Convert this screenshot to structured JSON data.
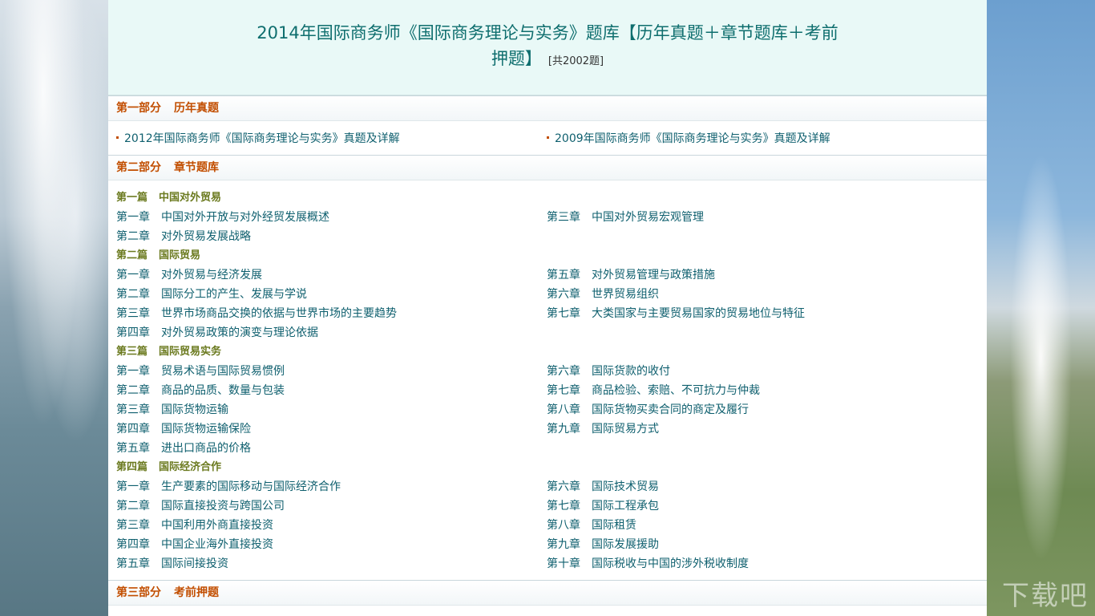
{
  "title_line1": "2014年国际商务师《国际商务理论与实务》题库【历年真题＋章节题库＋考前",
  "title_line2": "押题】",
  "title_count": "[共2002题]",
  "watermark": "下载吧",
  "sections": [
    {
      "label": "第一部分",
      "name": "历年真题",
      "links": [
        "2012年国际商务师《国际商务理论与实务》真题及详解",
        "2009年国际商务师《国际商务理论与实务》真题及详解"
      ]
    },
    {
      "label": "第二部分",
      "name": "章节题库",
      "parts": [
        {
          "label": "第一篇",
          "name": "中国对外贸易",
          "rows": [
            [
              {
                "n": "第一章",
                "t": "中国对外开放与对外经贸发展概述"
              },
              {
                "n": "第三章",
                "t": "中国对外贸易宏观管理"
              }
            ],
            [
              {
                "n": "第二章",
                "t": "对外贸易发展战略"
              },
              null
            ]
          ]
        },
        {
          "label": "第二篇",
          "name": "国际贸易",
          "rows": [
            [
              {
                "n": "第一章",
                "t": "对外贸易与经济发展"
              },
              {
                "n": "第五章",
                "t": "对外贸易管理与政策措施"
              }
            ],
            [
              {
                "n": "第二章",
                "t": "国际分工的产生、发展与学说"
              },
              {
                "n": "第六章",
                "t": "世界贸易组织"
              }
            ],
            [
              {
                "n": "第三章",
                "t": "世界市场商品交换的依据与世界市场的主要趋势"
              },
              {
                "n": "第七章",
                "t": "大类国家与主要贸易国家的贸易地位与特征"
              }
            ],
            [
              {
                "n": "第四章",
                "t": "对外贸易政策的演变与理论依据"
              },
              null
            ]
          ]
        },
        {
          "label": "第三篇",
          "name": "国际贸易实务",
          "rows": [
            [
              {
                "n": "第一章",
                "t": "贸易术语与国际贸易惯例"
              },
              {
                "n": "第六章",
                "t": "国际货款的收付"
              }
            ],
            [
              {
                "n": "第二章",
                "t": "商品的品质、数量与包装"
              },
              {
                "n": "第七章",
                "t": "商品检验、索赔、不可抗力与仲裁"
              }
            ],
            [
              {
                "n": "第三章",
                "t": "国际货物运输"
              },
              {
                "n": "第八章",
                "t": "国际货物买卖合同的商定及履行"
              }
            ],
            [
              {
                "n": "第四章",
                "t": "国际货物运输保险"
              },
              {
                "n": "第九章",
                "t": "国际贸易方式"
              }
            ],
            [
              {
                "n": "第五章",
                "t": "进出口商品的价格"
              },
              null
            ]
          ]
        },
        {
          "label": "第四篇",
          "name": "国际经济合作",
          "rows": [
            [
              {
                "n": "第一章",
                "t": "生产要素的国际移动与国际经济合作"
              },
              {
                "n": "第六章",
                "t": "国际技术贸易"
              }
            ],
            [
              {
                "n": "第二章",
                "t": "国际直接投资与跨国公司"
              },
              {
                "n": "第七章",
                "t": "国际工程承包"
              }
            ],
            [
              {
                "n": "第三章",
                "t": "中国利用外商直接投资"
              },
              {
                "n": "第八章",
                "t": "国际租赁"
              }
            ],
            [
              {
                "n": "第四章",
                "t": "中国企业海外直接投资"
              },
              {
                "n": "第九章",
                "t": "国际发展援助"
              }
            ],
            [
              {
                "n": "第五章",
                "t": "国际间接投资"
              },
              {
                "n": "第十章",
                "t": "国际税收与中国的涉外税收制度"
              }
            ]
          ]
        }
      ]
    },
    {
      "label": "第三部分",
      "name": "考前押题"
    }
  ]
}
